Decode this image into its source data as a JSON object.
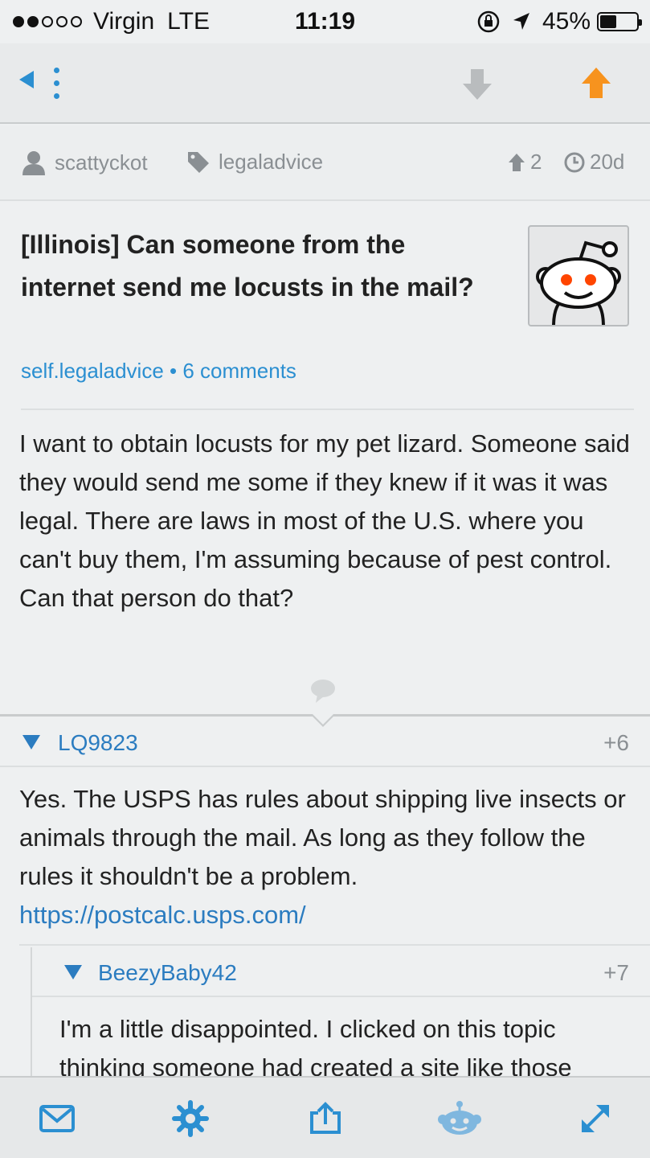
{
  "status_bar": {
    "carrier": "Virgin",
    "network": "LTE",
    "time": "11:19",
    "battery": "45%",
    "battery_level": 0.45
  },
  "nav": {
    "back_icon": "back-arrow-icon",
    "more_icon": "more-vertical-icon",
    "downvote_icon": "downvote-arrow-icon",
    "upvote_icon": "upvote-arrow-icon",
    "upvote_color": "#f7931e"
  },
  "meta": {
    "author": "scattyckot",
    "subreddit": "legaladvice",
    "score": "2",
    "age": "20d"
  },
  "post": {
    "title": "[Illinois] Can someone from the internet send me locusts in the mail?",
    "domain": "self.legaladvice • 6 comments",
    "body": "I want to obtain locusts for my pet lizard. Someone said they would send me some if they knew if it was it was legal. There are laws in most of the U.S. where you can't buy them, I'm assuming because of pest control. Can that person do that?"
  },
  "comments": [
    {
      "author": "LQ9823",
      "points": "+6",
      "body": "Yes. The USPS has rules about shipping live insects or animals through the mail. As long as they follow the rules it shouldn't be a problem.",
      "link": "https://postcalc.usps.com/"
    },
    {
      "author": "BeezyBaby42",
      "points": "+7",
      "body": "I'm a little disappointed. I clicked on this topic thinking someone had created a site like those"
    }
  ],
  "tab_bar": {
    "icons": [
      "mail-icon",
      "settings-gear-icon",
      "share-icon",
      "reddit-alien-icon",
      "expand-icon"
    ],
    "accent": "#2b8fd1"
  }
}
